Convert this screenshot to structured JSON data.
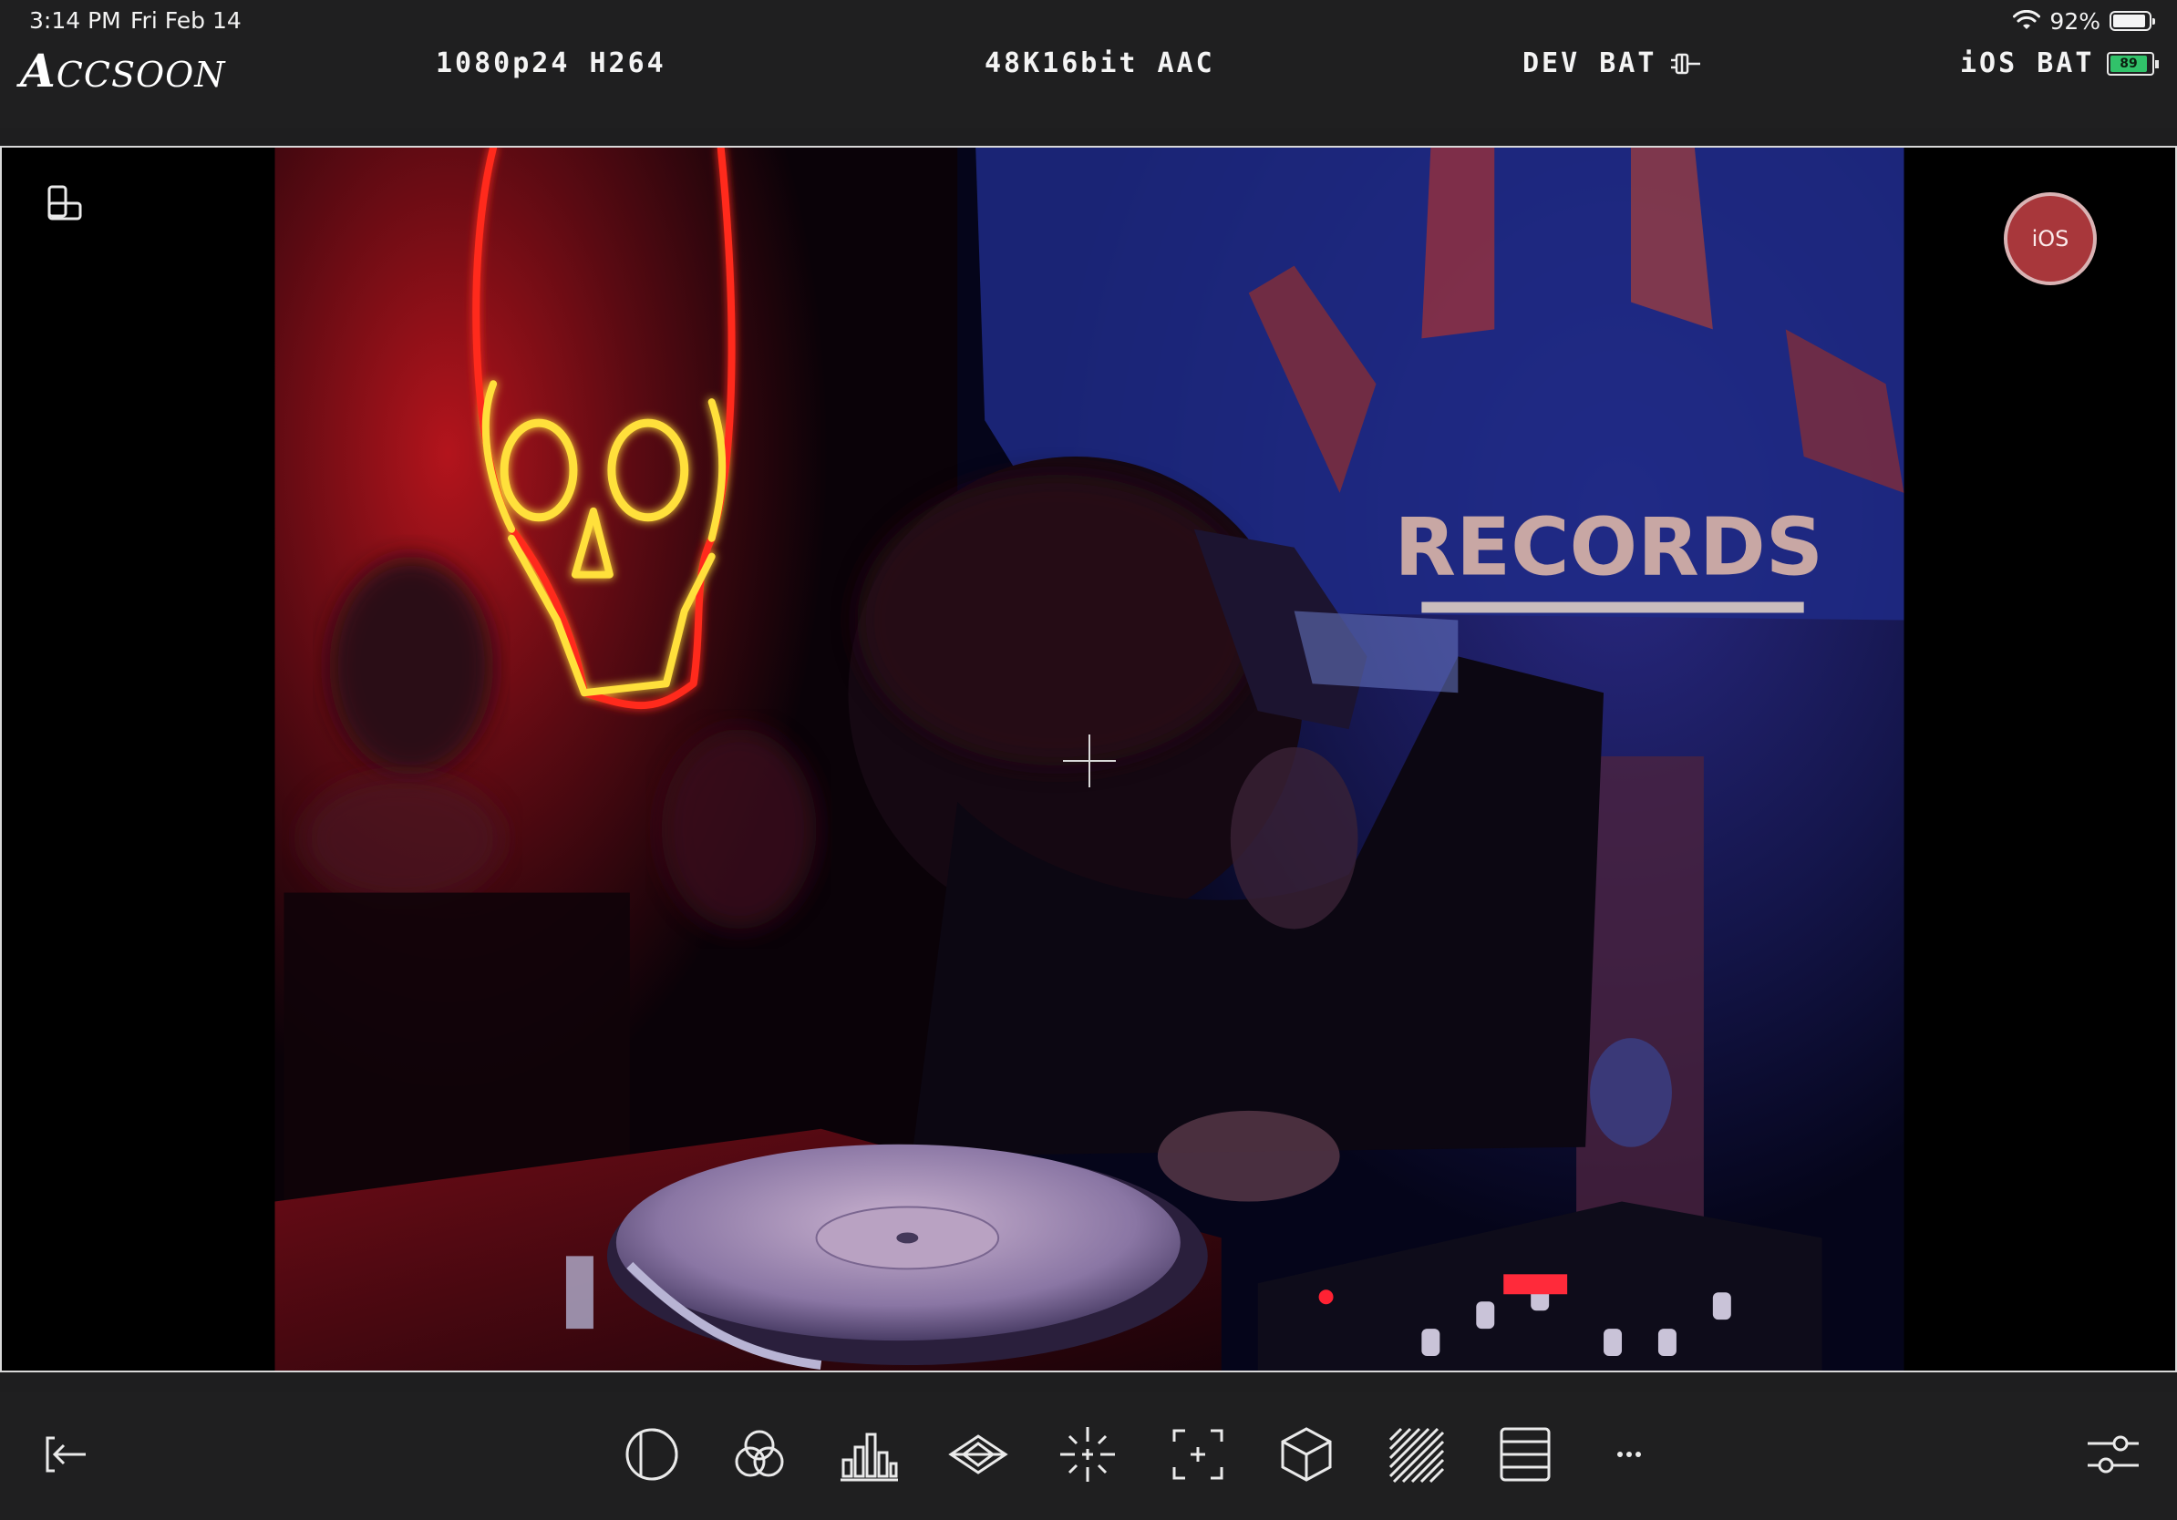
{
  "status_bar": {
    "time": "3:14 PM",
    "date": "Fri Feb 14",
    "battery_percent": "92%",
    "battery_level": 0.92
  },
  "header": {
    "brand": "ACCSOON",
    "video_format": "1080p24 H264",
    "audio_format": "48K16bit AAC",
    "dev_bat_label": "DEV BAT",
    "ios_bat_label": "iOS BAT",
    "ios_bat_value": "89",
    "ios_bat_color": "#31c26a"
  },
  "viewport": {
    "record_button_label": "iOS",
    "record_button_color": "#a8373b",
    "scene_sign_text": "RECORDS"
  },
  "toolbar": {
    "icons": [
      "exit-icon",
      "false-color-icon",
      "rgb-parade-icon",
      "histogram-icon",
      "vectorscope-icon",
      "focus-peaking-icon",
      "frame-guide-icon",
      "lut-cube-icon",
      "zebra-icon",
      "waveform-icon",
      "more-icon",
      "settings-sliders-icon"
    ],
    "more_label": "···"
  }
}
